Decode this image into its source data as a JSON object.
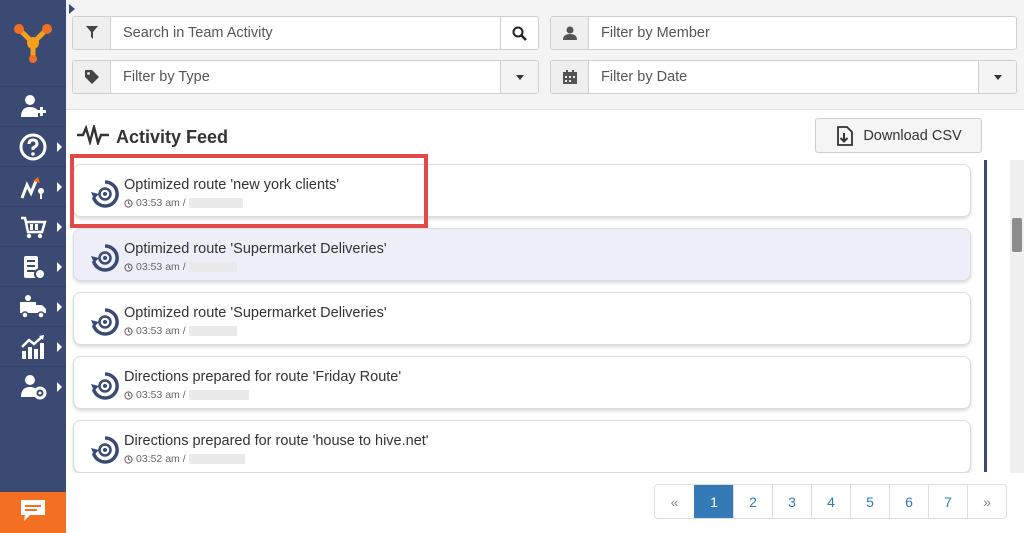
{
  "filters": {
    "search_placeholder": "Search in Team Activity",
    "member_placeholder": "Filter by Member",
    "type_placeholder": "Filter by Type",
    "date_placeholder": "Filter by Date"
  },
  "feed": {
    "title": "Activity Feed",
    "download_label": "Download CSV",
    "items": [
      {
        "title": "Optimized route 'new york clients'",
        "time": "03:53 am /"
      },
      {
        "title": "Optimized route 'Supermarket Deliveries'",
        "time": "03:53 am /"
      },
      {
        "title": "Optimized route 'Supermarket Deliveries'",
        "time": "03:53 am /"
      },
      {
        "title": "Directions prepared for route 'Friday Route'",
        "time": "03:53 am /"
      },
      {
        "title": "Directions prepared for route 'house to hive.net'",
        "time": "03:52 am /"
      }
    ]
  },
  "pagination": {
    "prev": "«",
    "pages": [
      "1",
      "2",
      "3",
      "4",
      "5",
      "6",
      "7"
    ],
    "next": "»",
    "active_page": "1"
  },
  "sidebar": {
    "items": [
      {
        "icon": "add-user-icon"
      },
      {
        "icon": "help-icon"
      },
      {
        "icon": "routes-icon"
      },
      {
        "icon": "cart-icon"
      },
      {
        "icon": "address-book-icon"
      },
      {
        "icon": "fleet-icon"
      },
      {
        "icon": "analytics-icon"
      },
      {
        "icon": "team-settings-icon"
      }
    ],
    "chat_icon": "chat-icon"
  },
  "colors": {
    "sidebar": "#3b4a72",
    "accent_orange": "#f36f21",
    "highlight_red": "#e24a4a",
    "active_page": "#337ab7",
    "highlighted_card": "#eeeef9"
  }
}
